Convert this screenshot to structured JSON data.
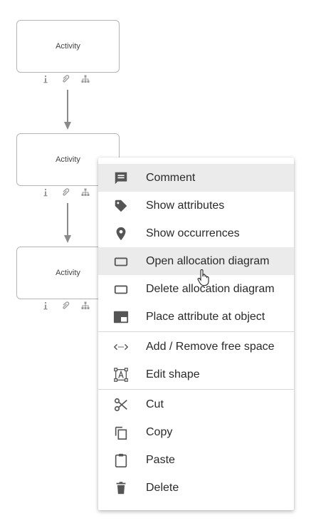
{
  "diagram": {
    "activities": [
      {
        "label": "Activity"
      },
      {
        "label": "Activity"
      },
      {
        "label": "Activity"
      }
    ],
    "shape_icons": [
      "info-icon",
      "attachment-icon",
      "hierarchy-icon"
    ]
  },
  "context_menu": {
    "groups": [
      [
        {
          "label": "Comment",
          "icon": "comment-icon"
        },
        {
          "label": "Show attributes",
          "icon": "tag-icon"
        },
        {
          "label": "Show occurrences",
          "icon": "location-pin-icon"
        },
        {
          "label": "Open allocation diagram",
          "icon": "rectangle-icon",
          "hovered": true
        },
        {
          "label": "Delete allocation diagram",
          "icon": "rectangle-icon"
        },
        {
          "label": "Place attribute at object",
          "icon": "place-attribute-icon"
        }
      ],
      [
        {
          "label": "Add / Remove free space",
          "icon": "free-space-icon"
        },
        {
          "label": "Edit shape",
          "icon": "edit-shape-icon"
        }
      ],
      [
        {
          "label": "Cut",
          "icon": "scissors-icon"
        },
        {
          "label": "Copy",
          "icon": "copy-icon"
        },
        {
          "label": "Paste",
          "icon": "clipboard-icon"
        },
        {
          "label": "Delete",
          "icon": "trash-icon"
        }
      ]
    ]
  },
  "colors": {
    "icon": "#555555",
    "highlight": "#ebebeb",
    "arrow": "#8a8a8a"
  }
}
